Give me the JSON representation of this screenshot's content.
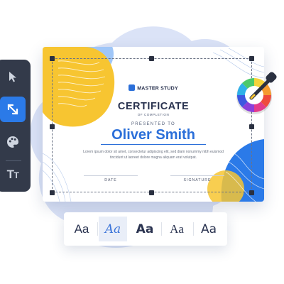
{
  "certificate": {
    "brand": "MASTER STUDY",
    "title": "CERTIFICATE",
    "subtitle": "OF COMPLETION",
    "presented_to": "PRESENTED TO",
    "recipient_name": "Oliver Smith",
    "body": "Lorem ipsum dolor sit amet, consectetur adipiscing elit, sed diam nonummy nibh euismod tincidunt ut laoreet dolore magna aliquam erat volutpat.",
    "date_label": "DATE",
    "signature_label": "SIGNATURE"
  },
  "toolbar": {
    "tools": [
      {
        "icon": "cursor-icon",
        "active": false
      },
      {
        "icon": "resize-icon",
        "active": true
      },
      {
        "icon": "palette-icon",
        "active": false
      },
      {
        "icon": "text-size-icon",
        "active": false
      }
    ],
    "text_tool_glyph": "Tт"
  },
  "font_picker": {
    "options": [
      {
        "label": "Aa",
        "style": "sans",
        "selected": false
      },
      {
        "label": "Aa",
        "style": "script-italic",
        "selected": true
      },
      {
        "label": "Aa",
        "style": "sans-bold",
        "selected": false
      },
      {
        "label": "Aa",
        "style": "serif",
        "selected": false
      },
      {
        "label": "Aa",
        "style": "rounded",
        "selected": false
      }
    ]
  },
  "colors": {
    "accent_blue": "#2b6fd9",
    "accent_yellow": "#f7c531",
    "toolbar_bg": "#333a4a",
    "background_blob": "#dbe3f7"
  },
  "color_picker": {
    "icon": "color-wheel-icon",
    "tool": "eyedropper-icon"
  }
}
